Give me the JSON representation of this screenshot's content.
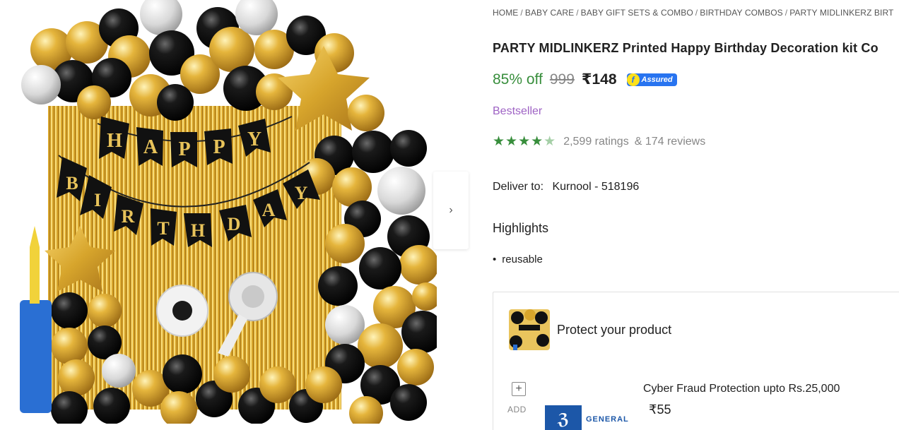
{
  "breadcrumb": [
    {
      "label": "HOME"
    },
    {
      "label": "BABY CARE"
    },
    {
      "label": "BABY GIFT SETS & COMBO"
    },
    {
      "label": "BIRTHDAY COMBOS"
    },
    {
      "label": "PARTY MIDLINKERZ BIRT"
    }
  ],
  "product": {
    "title": "PARTY MIDLINKERZ Printed Happy Birthday Decoration kit Co",
    "discount": "85% off",
    "mrp": "999",
    "price": "₹148",
    "assured_label": "Assured",
    "tag": "Bestseller",
    "rating_stars": 4.5,
    "ratings_text": "2,599 ratings",
    "reviews_text": "& 174 reviews"
  },
  "image_banner": {
    "line1": "HAPPY",
    "line2": "BIRTHDAY"
  },
  "delivery": {
    "label": "Deliver to:",
    "location": "Kurnool - 518196"
  },
  "highlights": {
    "title": "Highlights",
    "items": [
      "reusable"
    ]
  },
  "protection": {
    "title": "Protect your product",
    "add_label": "ADD",
    "plan_name": "Cyber Fraud Protection upto Rs.25,000",
    "plan_price": "₹55",
    "insurer_name": "GENERAL"
  },
  "colors": {
    "discount_green": "#388e3c",
    "star_green": "#388e3c",
    "bestseller_purple": "#9e62c4",
    "assured_blue": "#2874f0"
  },
  "icons": {
    "next": "chevron-right-icon",
    "add": "plus-icon"
  }
}
